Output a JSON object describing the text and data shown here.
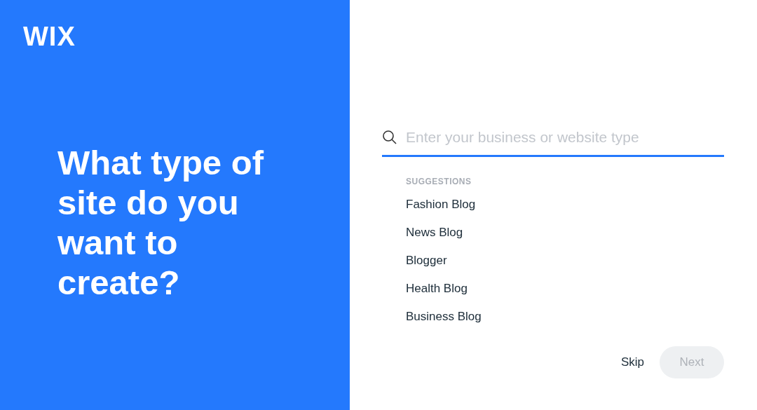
{
  "logo": "WIX",
  "heading": "What type of site do you want to create?",
  "search": {
    "placeholder": "Enter your business or website type"
  },
  "suggestions": {
    "title": "SUGGESTIONS",
    "items": [
      "Fashion Blog",
      "News Blog",
      "Blogger",
      "Health Blog",
      "Business Blog"
    ]
  },
  "buttons": {
    "skip": "Skip",
    "next": {
      "label": "Next",
      "disabled": true
    }
  }
}
